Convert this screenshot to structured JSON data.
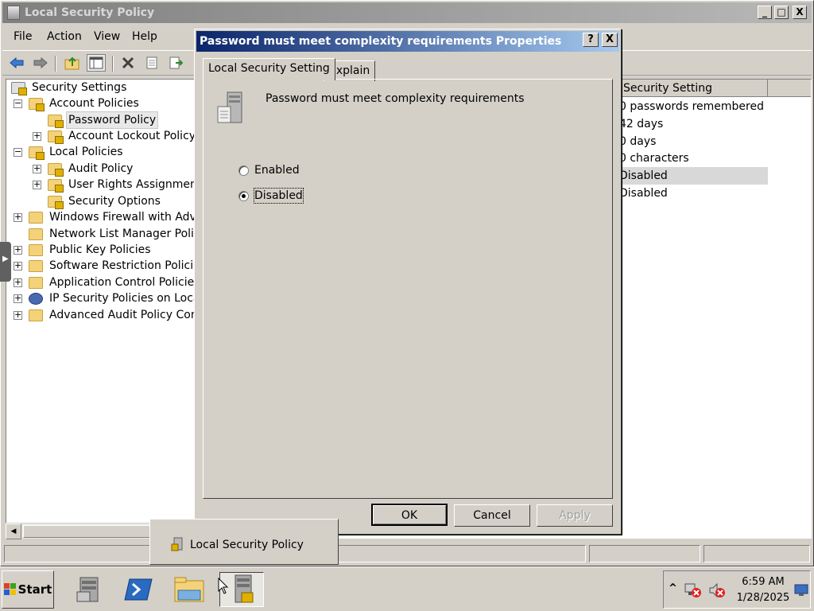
{
  "main_window": {
    "title": "Local Security Policy",
    "controls": {
      "minimize": "_",
      "maximize": "□",
      "close": "X"
    }
  },
  "menu": [
    "File",
    "Action",
    "View",
    "Help"
  ],
  "toolbar": {
    "icons": [
      "back-arrow-icon",
      "forward-arrow-icon",
      "up-folder-icon",
      "show-hide-tree-icon",
      "delete-icon",
      "properties-icon",
      "export-list-icon"
    ]
  },
  "tree": {
    "root": "Security Settings",
    "items": [
      {
        "label": "Account Policies",
        "expander": "−"
      },
      {
        "label": "Password Policy",
        "selected": true
      },
      {
        "label": "Account Lockout Policy",
        "expander": "+"
      },
      {
        "label": "Local Policies",
        "expander": "−"
      },
      {
        "label": "Audit Policy",
        "expander": "+"
      },
      {
        "label": "User Rights Assignment",
        "expander": "+"
      },
      {
        "label": "Security Options"
      },
      {
        "label": "Windows Firewall with Advanc",
        "expander": "+"
      },
      {
        "label": "Network List Manager Policies"
      },
      {
        "label": "Public Key Policies",
        "expander": "+"
      },
      {
        "label": "Software Restriction Policies",
        "expander": "+"
      },
      {
        "label": "Application Control Policies",
        "expander": "+"
      },
      {
        "label": "IP Security Policies on Local C",
        "expander": "+"
      },
      {
        "label": "Advanced Audit Policy Configu",
        "expander": "+"
      }
    ]
  },
  "list": {
    "column_header": "Security Setting",
    "values": [
      "0 passwords remembered",
      "42 days",
      "0 days",
      "0 characters",
      "Disabled",
      "Disabled"
    ]
  },
  "dialog": {
    "title": "Password must meet complexity requirements Properties",
    "help_button": "?",
    "close_button": "X",
    "tabs": [
      "Local Security Setting",
      "Explain"
    ],
    "policy_name": "Password must meet complexity requirements",
    "options": {
      "enabled": "Enabled",
      "disabled": "Disabled"
    },
    "selected_option": "Disabled",
    "buttons": {
      "ok": "OK",
      "cancel": "Cancel",
      "apply": "Apply"
    }
  },
  "taskbar_popup": {
    "label": "Local Security Policy"
  },
  "taskbar": {
    "start_label": "Start",
    "tray_chevron": "^",
    "time": "6:59 AM",
    "date": "1/28/2025"
  }
}
